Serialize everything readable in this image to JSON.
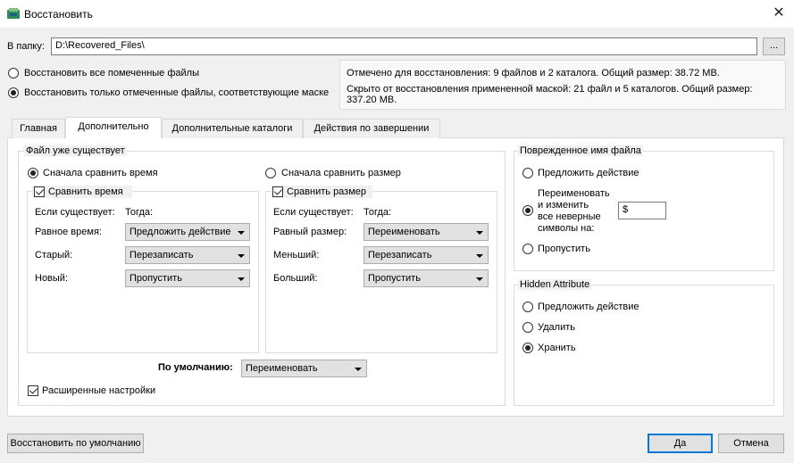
{
  "window": {
    "title": "Восстановить",
    "close": "✕"
  },
  "folder": {
    "label": "В папку:",
    "value": "D:\\Recovered_Files\\",
    "browse": "..."
  },
  "scope": {
    "all_label": "Восстановить все помеченные файлы",
    "masked_label": "Восстановить только отмеченные файлы, соответствующие маске",
    "selected": "masked"
  },
  "info": {
    "line1": "Отмечено для восстановления: 9 файлов и 2 каталога. Общий размер: 38.72 MB.",
    "line2a": "Скрыто от восстановления примененной маской: 21 файл и 5 каталогов. Общий размер:",
    "line2b": "337.20 MB."
  },
  "tabs": [
    "Главная",
    "Дополнительно",
    "Дополнительные каталоги",
    "Действия по завершении"
  ],
  "active_tab": 1,
  "file_exists": {
    "legend": "Файл уже существует",
    "compare_time_label": "Сначала сравнить время",
    "compare_size_label": "Сначала сравнить размер",
    "time": {
      "checkbox": "Сравнить время",
      "if_exists": "Если существует:",
      "then": "Тогда:",
      "rows": [
        {
          "label": "Равное время:",
          "value": "Предложить действие"
        },
        {
          "label": "Старый:",
          "value": "Перезаписать"
        },
        {
          "label": "Новый:",
          "value": "Пропустить"
        }
      ]
    },
    "size": {
      "checkbox": "Сравнить размер",
      "if_exists": "Если существует:",
      "then": "Тогда:",
      "rows": [
        {
          "label": "Равный размер:",
          "value": "Переименовать"
        },
        {
          "label": "Меньший:",
          "value": "Перезаписать"
        },
        {
          "label": "Больший:",
          "value": "Пропустить"
        }
      ]
    },
    "default_label": "По умолчанию:",
    "default_value": "Переименовать",
    "advanced_label": "Расширенные настройки"
  },
  "damaged_name": {
    "legend": "Поврежденное имя файла",
    "suggest": "Предложить действие",
    "rename_l1": "Переименовать",
    "rename_l2": "и изменить",
    "rename_l3": "все неверные",
    "rename_l4": "символы на:",
    "rename_value": "$",
    "skip": "Пропустить"
  },
  "hidden_attr": {
    "legend": "Hidden Attribute",
    "suggest": "Предложить действие",
    "delete": "Удалить",
    "keep": "Хранить"
  },
  "footer": {
    "restore_defaults": "Восстановить по умолчанию",
    "ok": "Да",
    "cancel": "Отмена"
  }
}
